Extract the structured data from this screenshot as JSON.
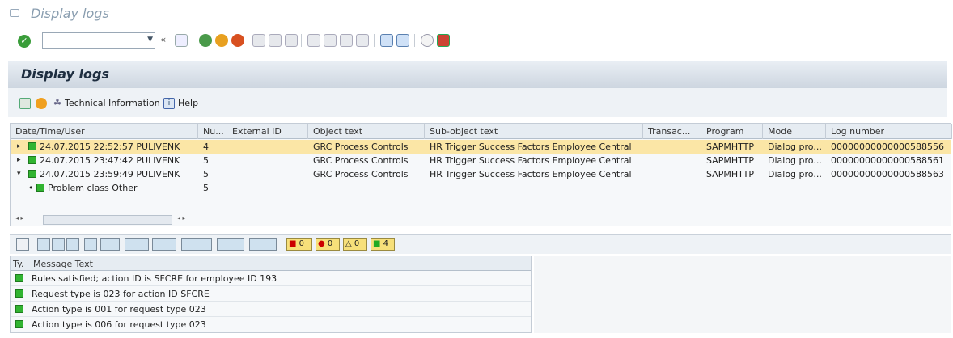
{
  "window": {
    "title": "Display logs"
  },
  "section_title": "Display logs",
  "app_toolbar": {
    "tech_info": "Technical Information",
    "help": "Help"
  },
  "log_table": {
    "headers": [
      "Date/Time/User",
      "Nu...",
      "External ID",
      "Object text",
      "Sub-object text",
      "Transac...",
      "Program",
      "Mode",
      "Log number"
    ],
    "rows": [
      {
        "datetime": "24.07.2015  22:52:57  PULIVENK",
        "num": "4",
        "external": "",
        "object": "GRC Process Controls",
        "subobject": "HR Trigger Success Factors Employee Central",
        "transac": "",
        "program": "SAPMHTTP",
        "mode": "Dialog pro...",
        "log": "00000000000000588556",
        "expand": "▸",
        "selected": true
      },
      {
        "datetime": "24.07.2015  23:47:42  PULIVENK",
        "num": "5",
        "external": "",
        "object": "GRC Process Controls",
        "subobject": "HR Trigger Success Factors Employee Central",
        "transac": "",
        "program": "SAPMHTTP",
        "mode": "Dialog pro...",
        "log": "00000000000000588561",
        "expand": "▸",
        "selected": false
      },
      {
        "datetime": "24.07.2015  23:59:49  PULIVENK",
        "num": "5",
        "external": "",
        "object": "GRC Process Controls",
        "subobject": "HR Trigger Success Factors Employee Central",
        "transac": "",
        "program": "SAPMHTTP",
        "mode": "Dialog pro...",
        "log": "00000000000000588563",
        "expand": "▾",
        "selected": false
      }
    ],
    "subrow": {
      "label": "Problem class Other",
      "num": "5"
    }
  },
  "msg_counts": {
    "stop": "0",
    "error": "0",
    "warning": "0",
    "success": "4"
  },
  "messages": {
    "headers": [
      "Ty.",
      "Message Text"
    ],
    "rows": [
      "Rules satisfied; action ID is SFCRE for employee ID 193",
      "Request type is 023 for action ID SFCRE",
      "Action type is 001 for request type 023",
      "Action type is 006 for request type 023"
    ]
  },
  "icons": [
    "window-icon",
    "check-icon",
    "back-icon",
    "save-icon",
    "print-icon",
    "find-icon",
    "page-icon",
    "layout-icon",
    "help-icon",
    "detail-icon",
    "tech-info-icon",
    "help-book-icon"
  ],
  "colors": {
    "success": "#31b431",
    "selected_row": "#fbe6a6",
    "header_bg": "#e6ecf2"
  }
}
